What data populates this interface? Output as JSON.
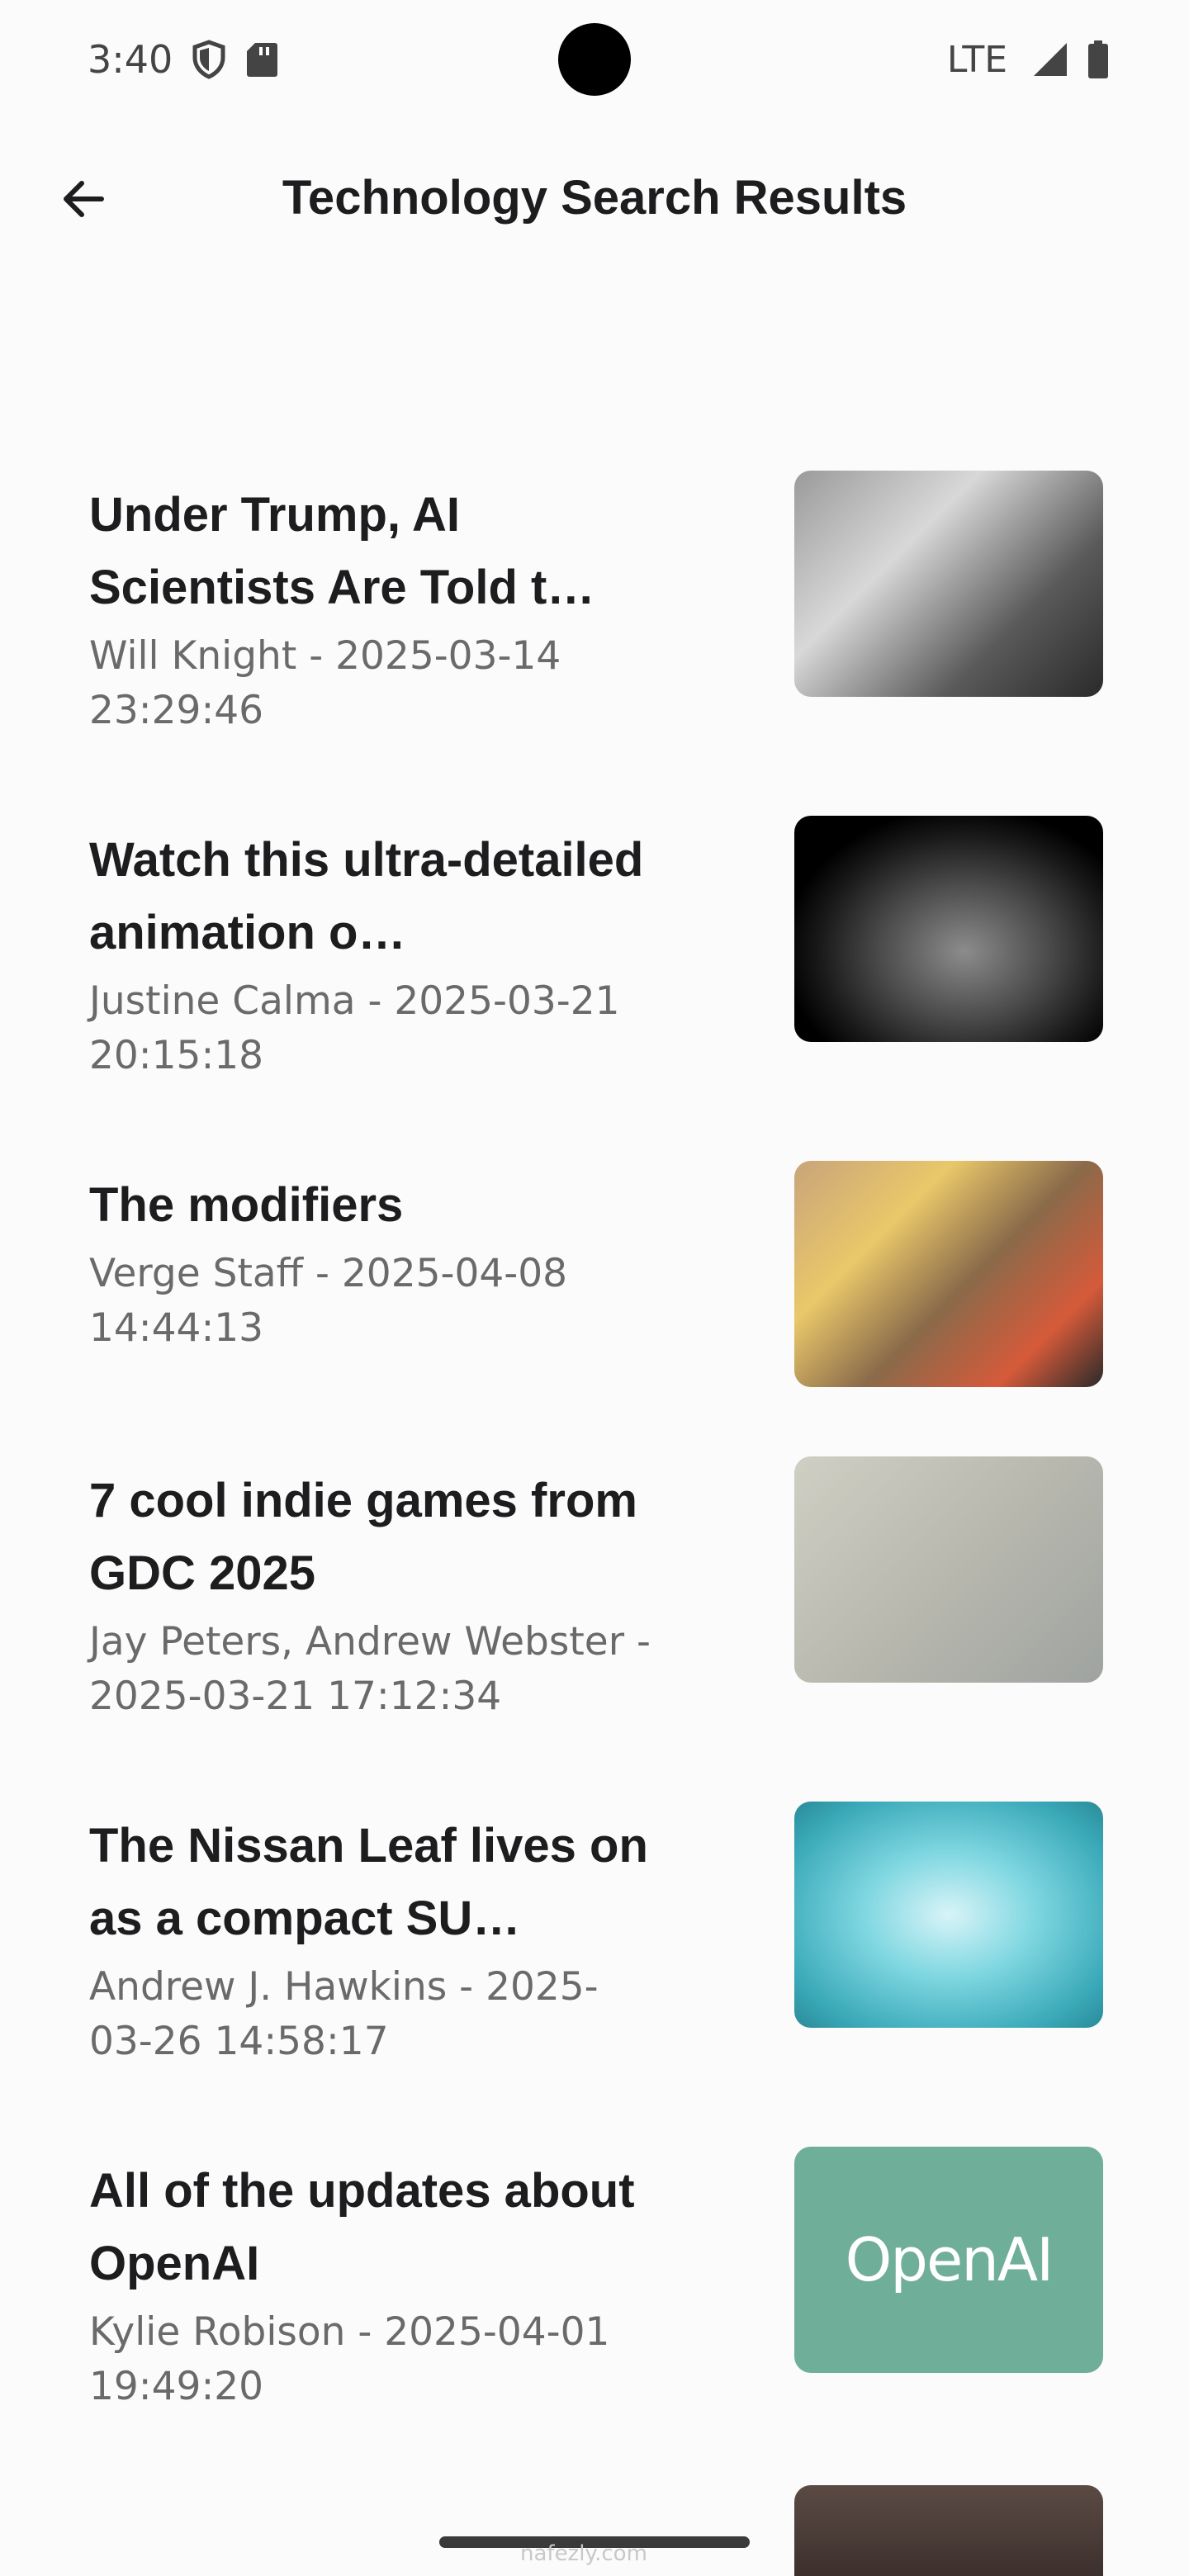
{
  "status_bar": {
    "time": "3:40",
    "network": "LTE",
    "icons": [
      "shield-icon",
      "sd-card-icon",
      "signal-icon",
      "battery-icon"
    ]
  },
  "app_bar": {
    "title": "Technology Search Results",
    "back_icon": "arrow-back-icon"
  },
  "results": [
    {
      "title": "Under Trump, AI Scientists Are Told t…",
      "meta": "Will Knight - 2025-03-14 23:29:46",
      "thumb": "trump-photo"
    },
    {
      "title": "Watch this ultra-detailed animation o…",
      "meta": "Justine Calma - 2025-03-21 20:15:18",
      "thumb": "terrain-animation"
    },
    {
      "title": "The modifiers",
      "meta": "Verge Staff - 2025-04-08 14:44:13",
      "thumb": "collage-illustration"
    },
    {
      "title": "7 cool indie games from GDC 2025",
      "meta": "Jay Peters, Andrew Webster - 2025-03-21 17:12:34",
      "thumb": "game-screenshot"
    },
    {
      "title": "The Nissan Leaf lives on as a compact SU…",
      "meta": "Andrew J. Hawkins - 2025-03-26 14:58:17",
      "thumb": "car-photo"
    },
    {
      "title": "All of the updates about OpenAI",
      "meta": "Kylie Robison - 2025-04-01 19:49:20",
      "thumb": "openai-logo",
      "thumb_text": "OpenAI"
    }
  ],
  "watermark": "nafezly.com",
  "colors": {
    "background": "#fbfbfb",
    "title_text": "#1d1d1f",
    "meta_text": "#6a6a6a",
    "openai_green": "#6fae99"
  }
}
